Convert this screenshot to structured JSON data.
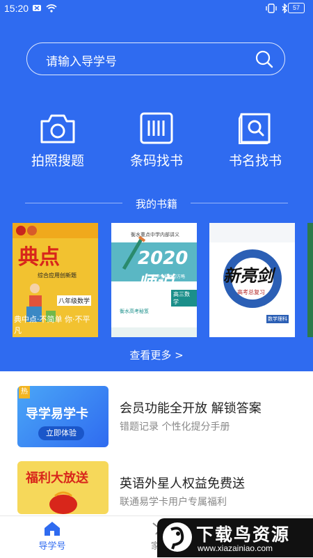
{
  "status_bar": {
    "time": "15:20",
    "battery": "57"
  },
  "search": {
    "placeholder": "请输入导学号"
  },
  "actions": [
    {
      "label": "拍照搜题",
      "icon": "camera-icon"
    },
    {
      "label": "条码找书",
      "icon": "barcode-icon"
    },
    {
      "label": "书名找书",
      "icon": "book-search-icon"
    }
  ],
  "my_books": {
    "title": "我的书籍",
    "books": [
      {
        "title": "典点",
        "tags": [
          "综合应用创新题",
          "八年级数学"
        ],
        "slogan": "典中点·不简单 你·不平凡"
      },
      {
        "title": "2020 师说",
        "tags": [
          "衡水重点中学内部讲义",
          "高中全程复习方略",
          "高三数学",
          "衡水高考秘笈"
        ]
      },
      {
        "title": "新亮剑",
        "tags": [
          "高考总复习",
          "数学理科"
        ]
      }
    ],
    "more": "查看更多 >"
  },
  "promos": [
    {
      "banner_text": "导学易学卡",
      "banner_button": "立即体验",
      "banner_tag": "热",
      "title": "会员功能全开放 解锁答案",
      "subtitle": "错题记录 个性化提分手册"
    },
    {
      "banner_text": "福利大放送",
      "title": "英语外星人权益免费送",
      "subtitle": "联通易学卡用户专属福利"
    }
  ],
  "tabs": [
    {
      "label": "导学号",
      "icon": "home-icon",
      "active": true
    },
    {
      "label": "家长",
      "icon": "parent-icon",
      "active": false
    }
  ],
  "watermark": {
    "title": "下载鸟资源",
    "url": "www.xiazainiao.com"
  },
  "colors": {
    "primary": "#2f6bf0",
    "banner_blue": "#3b8af5",
    "banner_yellow": "#f6d85a"
  }
}
